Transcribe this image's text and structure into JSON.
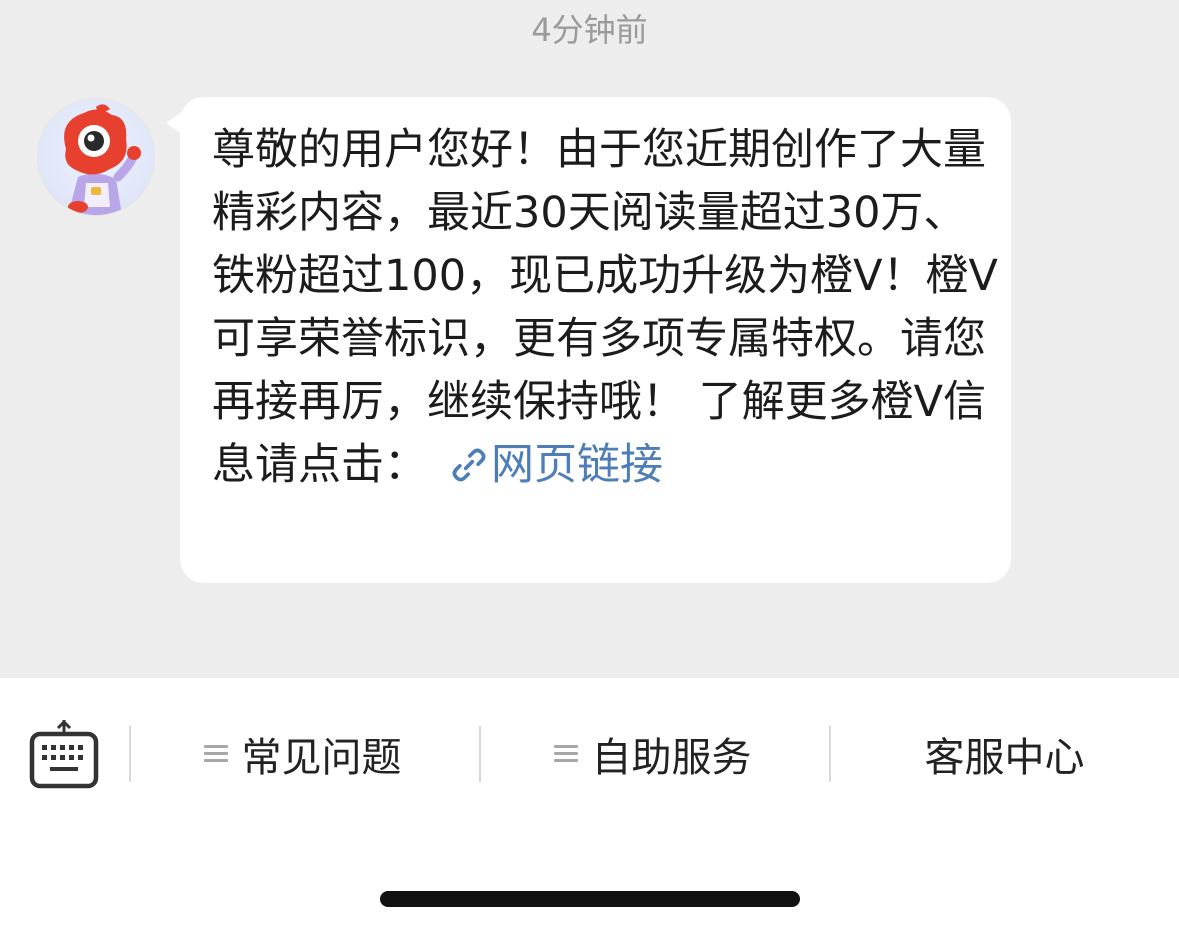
{
  "chat": {
    "timestamp": "4分钟前",
    "message": {
      "text": "尊敬的用户您好！由于您近期创作了大量精彩内容，最近30天阅读量超过30万、铁粉超过100，现已成功升级为橙V！橙V可享荣誉标识，更有多项专属特权。请您再接再厉，继续保持哦！ 了解更多橙V信息请点击：",
      "link_label": "网页链接",
      "link_icon": "link-icon"
    },
    "avatar_icon": "mascot-avatar"
  },
  "toolbar": {
    "keyboard_icon": "keyboard-icon",
    "items": [
      {
        "label": "常见问题",
        "icon": "menu-icon"
      },
      {
        "label": "自助服务",
        "icon": "menu-icon"
      },
      {
        "label": "客服中心"
      }
    ]
  },
  "colors": {
    "chat_background": "#ededed",
    "bubble": "#ffffff",
    "link": "#4e7eb7",
    "timestamp": "#9a9a9a"
  }
}
